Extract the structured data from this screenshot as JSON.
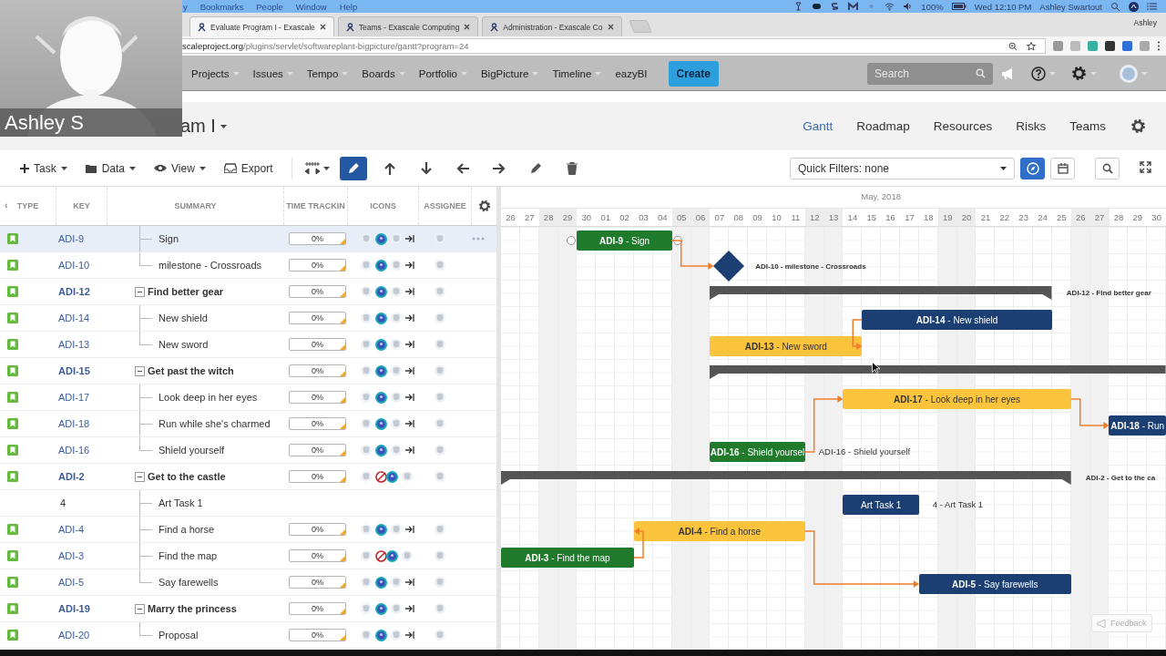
{
  "webcam": {
    "name": "Ashley S"
  },
  "menubar": {
    "menus": [
      "y",
      "Bookmarks",
      "People",
      "Window",
      "Help"
    ],
    "battery": "100%",
    "clock": "Wed 12:10 PM",
    "user": "Ashley Swartout"
  },
  "browser": {
    "tabs": [
      {
        "title": "Evaluate Program I - Exascale",
        "selected": true
      },
      {
        "title": "Teams - Exascale Computing",
        "selected": false
      },
      {
        "title": "Administration - Exascale Co",
        "selected": false
      }
    ],
    "profile": "Ashley",
    "url_host": "scaleproject.org",
    "url_path": "/plugins/servlet/softwareplant-bigpicture/gantt?program=24"
  },
  "nav": {
    "items": [
      {
        "label": "Projects",
        "dropdown": true
      },
      {
        "label": "Issues",
        "dropdown": true
      },
      {
        "label": "Tempo",
        "dropdown": true
      },
      {
        "label": "Boards",
        "dropdown": true
      },
      {
        "label": "Portfolio",
        "dropdown": true
      },
      {
        "label": "BigPicture",
        "dropdown": true
      },
      {
        "label": "Timeline",
        "dropdown": true
      },
      {
        "label": "eazyBI",
        "dropdown": false
      }
    ],
    "create": "Create",
    "search": {
      "placeholder": "Search"
    }
  },
  "program": {
    "title": "am I",
    "views": [
      {
        "label": "Gantt",
        "selected": true
      },
      {
        "label": "Roadmap",
        "selected": false
      },
      {
        "label": "Resources",
        "selected": false
      },
      {
        "label": "Risks",
        "selected": false
      },
      {
        "label": "Teams",
        "selected": false
      }
    ]
  },
  "toolbar": {
    "menus": [
      {
        "kind": "add",
        "label": "Task",
        "dropdown": true
      },
      {
        "kind": "folder",
        "label": "Data",
        "dropdown": true
      },
      {
        "kind": "eye",
        "label": "View",
        "dropdown": true
      },
      {
        "kind": "export",
        "label": "Export",
        "dropdown": false
      }
    ],
    "edit_mode": true,
    "quick_filter": "Quick Filters: none",
    "tools": [
      {
        "kind": "compass",
        "selected": true
      },
      {
        "kind": "calendar",
        "selected": false
      },
      {
        "kind": "search",
        "selected": false
      }
    ]
  },
  "table": {
    "scroll_left": "‹",
    "columns": [
      "TYPE",
      "KEY",
      "SUMMARY",
      "TIME TRACKIN",
      "ICONS",
      "ASSIGNEE"
    ],
    "rows": [
      {
        "children": [
          {
            "kind": "story",
            "key": "ADI-9",
            "summary": "Sign",
            "selected": true,
            "blocked": false,
            "progress": {
              "text": "0%",
              "level": 0
            },
            "bar": {
              "kind": "task",
              "color": "#1f7a2c",
              "inside": "**ADI-9** - Sign"
            }
          },
          {
            "kind": "story",
            "key": "ADI-10",
            "summary": "milestone - Crossroads",
            "selected": false,
            "blocked": false,
            "progress": {
              "text": "0%",
              "level": 0
            },
            "bar": {
              "kind": "milestone",
              "color": "#1b3f72",
              "outside": "ADI-10 - milestone - Crossroads"
            }
          }
        ]
      },
      {
        "kind": "story",
        "key": "ADI-12",
        "summary": "Find better gear",
        "selected": false,
        "expanded": true,
        "blocked": false,
        "progress": {
          "text": "0%",
          "level": 0
        },
        "bar": {
          "kind": "summary",
          "outside": "ADI-12 - Find better gear"
        },
        "children": [
          {
            "kind": "story",
            "key": "ADI-14",
            "summary": "New shield",
            "selected": false,
            "blocked": false,
            "progress": {
              "text": "0%",
              "level": 0
            },
            "bar": {
              "kind": "task",
              "color": "#1b3f72",
              "inside": "**ADI-14** - New shield"
            }
          },
          {
            "kind": "story",
            "key": "ADI-13",
            "summary": "New sword",
            "selected": false,
            "blocked": false,
            "progress": {
              "text": "0%",
              "level": 0
            },
            "bar": {
              "kind": "task",
              "color": "#fcc43d",
              "inside": "**ADI-13** - New sword"
            }
          }
        ]
      },
      {
        "kind": "story",
        "key": "ADI-15",
        "summary": "Get past the witch",
        "selected": false,
        "expanded": true,
        "blocked": false,
        "progress": {
          "text": "0%",
          "level": 0
        },
        "bar": {
          "kind": "summary"
        },
        "children": [
          {
            "kind": "story",
            "key": "ADI-17",
            "summary": "Look deep in her eyes",
            "selected": false,
            "blocked": false,
            "progress": {
              "text": "0%",
              "level": 0
            },
            "bar": {
              "kind": "task",
              "color": "#fcc43d",
              "inside": "**ADI-17** - Look deep in her eyes"
            }
          },
          {
            "kind": "story",
            "key": "ADI-18",
            "summary": "Run while she's charmed",
            "selected": false,
            "blocked": false,
            "progress": {
              "text": "0%",
              "level": 0
            },
            "bar": {
              "kind": "task",
              "color": "#1b3f72",
              "inside": "**ADI-18** - Run"
            }
          },
          {
            "kind": "story",
            "key": "ADI-16",
            "summary": "Shield yourself",
            "selected": false,
            "blocked": false,
            "progress": {
              "text": "0%",
              "level": 0
            },
            "bar": {
              "kind": "task",
              "color": "#1f7a2c",
              "inside": "**ADI-16** - Shield yoursel",
              "outside": "ADI-16 - Shield yourself"
            }
          }
        ]
      },
      {
        "kind": "story",
        "key": "ADI-2",
        "summary": "Get to the castle",
        "selected": false,
        "expanded": true,
        "blocked": true,
        "progress": {
          "text": "0%",
          "level": 0
        },
        "bar": {
          "kind": "summary",
          "outside": "ADI-2 - Get to the ca"
        },
        "children": [
          {
            "kind": "task",
            "key": "4",
            "summary": "Art Task 1",
            "selected": false,
            "bar": {
              "kind": "task",
              "color": "#1b3f72",
              "inside": "Art Task 1",
              "outside": "4 - Art Task 1"
            }
          },
          {
            "kind": "story",
            "key": "ADI-4",
            "summary": "Find a horse",
            "selected": false,
            "blocked": false,
            "progress": {
              "text": "0%",
              "level": 0
            },
            "bar": {
              "kind": "task",
              "color": "#fcc43d",
              "inside": "**ADI-4** - Find a horse"
            }
          },
          {
            "kind": "story",
            "key": "ADI-3",
            "summary": "Find the map",
            "selected": false,
            "blocked": true,
            "progress": {
              "text": "0%",
              "level": 0
            },
            "bar": {
              "kind": "task",
              "color": "#1f7a2c",
              "inside": "**ADI-3** - Find the map"
            }
          },
          {
            "kind": "story",
            "key": "ADI-5",
            "summary": "Say farewells",
            "selected": false,
            "blocked": false,
            "progress": {
              "text": "0%",
              "level": 0
            },
            "bar": {
              "kind": "task",
              "color": "#1b3f72",
              "inside": "**ADI-5** - Say farewells"
            }
          }
        ]
      },
      {
        "kind": "story",
        "key": "ADI-19",
        "summary": "Marry the princess",
        "selected": false,
        "expanded": true,
        "blocked": false,
        "progress": {
          "text": "0%",
          "level": 0
        },
        "children": [
          {
            "kind": "story",
            "key": "ADI-20",
            "summary": "Proposal",
            "selected": false,
            "blocked": false,
            "progress": {
              "text": "0%",
              "level": 0
            }
          }
        ]
      }
    ]
  },
  "timeline": {
    "month": "May, 2018",
    "days": [
      {
        "label": "26",
        "weekend": false
      },
      {
        "label": "27",
        "weekend": false
      },
      {
        "label": "28",
        "weekend": true
      },
      {
        "label": "29",
        "weekend": true
      },
      {
        "label": "30",
        "weekend": false
      },
      {
        "label": "01",
        "weekend": false
      },
      {
        "label": "02",
        "weekend": false
      },
      {
        "label": "03",
        "weekend": false
      },
      {
        "label": "04",
        "weekend": false
      },
      {
        "label": "05",
        "weekend": true
      },
      {
        "label": "06",
        "weekend": true
      },
      {
        "label": "07",
        "weekend": false
      },
      {
        "label": "08",
        "weekend": false
      },
      {
        "label": "09",
        "weekend": false
      },
      {
        "label": "10",
        "weekend": false
      },
      {
        "label": "11",
        "weekend": false
      },
      {
        "label": "12",
        "weekend": true
      },
      {
        "label": "13",
        "weekend": true
      },
      {
        "label": "14",
        "weekend": false
      },
      {
        "label": "15",
        "weekend": false
      },
      {
        "label": "16",
        "weekend": false
      },
      {
        "label": "17",
        "weekend": false
      },
      {
        "label": "18",
        "weekend": false
      },
      {
        "label": "19",
        "weekend": true
      },
      {
        "label": "20",
        "weekend": true
      },
      {
        "label": "21",
        "weekend": false
      },
      {
        "label": "22",
        "weekend": false
      },
      {
        "label": "23",
        "weekend": false
      },
      {
        "label": "24",
        "weekend": false
      },
      {
        "label": "25",
        "weekend": false
      },
      {
        "label": "26",
        "weekend": true
      },
      {
        "label": "27",
        "weekend": true
      },
      {
        "label": "28",
        "weekend": false
      },
      {
        "label": "29",
        "weekend": false
      },
      {
        "label": "30",
        "weekend": false
      }
    ]
  },
  "feedback": "Feedback"
}
